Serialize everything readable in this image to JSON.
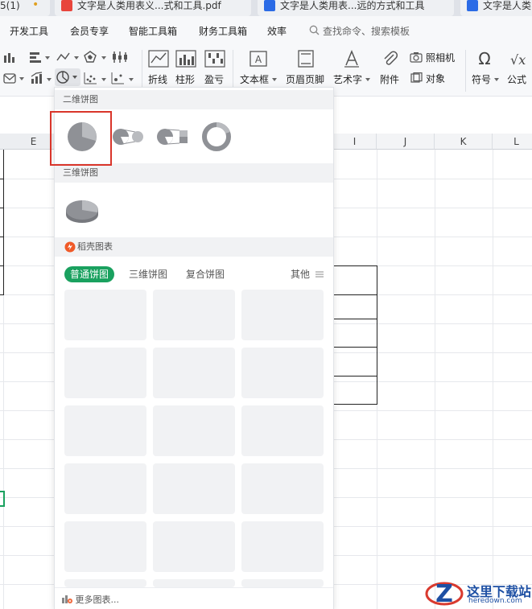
{
  "tabs": [
    {
      "label": "5(1)",
      "dot": "•"
    },
    {
      "label": "文字是人类用表义...式和工具.pdf",
      "icon": "pdf-icon",
      "color": "#e8453c"
    },
    {
      "label": "文字是人类用表...远的方式和工具",
      "icon": "word-icon",
      "color": "#2b6be6"
    },
    {
      "label": "文字是人类",
      "icon": "word-icon",
      "color": "#2b6be6"
    }
  ],
  "menu": {
    "items": [
      "开发工具",
      "会员专享",
      "智能工具箱",
      "财务工具箱",
      "效率"
    ],
    "search_placeholder": "查找命令、搜索模板"
  },
  "ribbon": {
    "line": "折线",
    "column": "柱形",
    "winloss": "盈亏",
    "textbox": "文本框",
    "header_footer": "页眉页脚",
    "wordart": "艺术字",
    "attachment": "附件",
    "camera": "照相机",
    "object": "对象",
    "symbol": "符号",
    "formula": "公式"
  },
  "sheet": {
    "columns": [
      "E",
      "I",
      "J",
      "K",
      "L"
    ]
  },
  "dropdown": {
    "section_2d": "二维饼图",
    "section_3d": "三维饼图",
    "section_daoke": "稻壳图表",
    "subtabs": {
      "normal": "普通饼图",
      "three_d": "三维饼图",
      "compound": "复合饼图",
      "other": "其他"
    },
    "more_charts": "更多图表..."
  },
  "watermark": {
    "title": "这里下载站",
    "domain": "heredown.com"
  },
  "colors": {
    "accent_green": "#1aa15f",
    "selection_red": "#d9352a",
    "daoke_orange": "#f05a28"
  }
}
